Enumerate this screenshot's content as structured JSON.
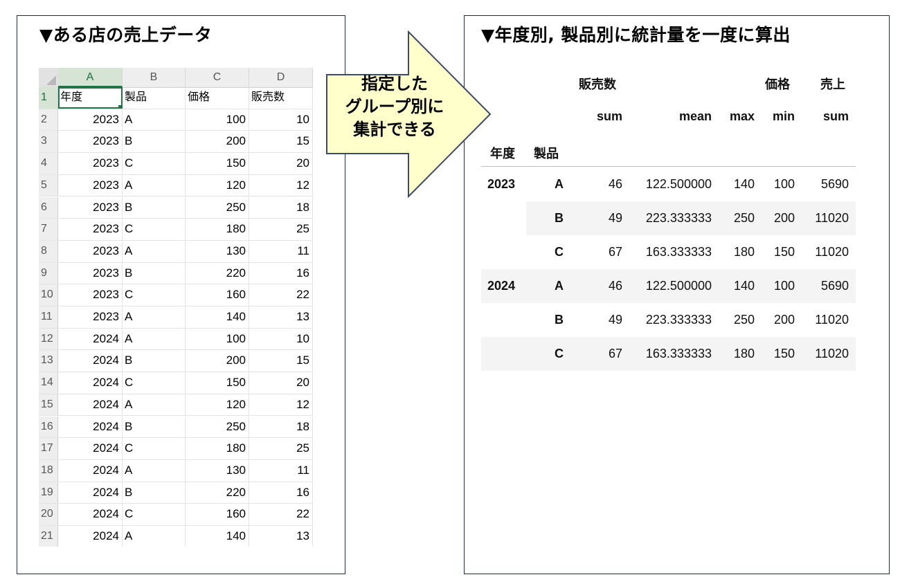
{
  "left": {
    "title": "▼ある店の売上データ",
    "sheet": {
      "columns": [
        "A",
        "B",
        "C",
        "D"
      ],
      "header": [
        "年度",
        "製品",
        "価格",
        "販売数"
      ],
      "rows": [
        [
          "2",
          "2023",
          "A",
          "100",
          "10"
        ],
        [
          "3",
          "2023",
          "B",
          "200",
          "15"
        ],
        [
          "4",
          "2023",
          "C",
          "150",
          "20"
        ],
        [
          "5",
          "2023",
          "A",
          "120",
          "12"
        ],
        [
          "6",
          "2023",
          "B",
          "250",
          "18"
        ],
        [
          "7",
          "2023",
          "C",
          "180",
          "25"
        ],
        [
          "8",
          "2023",
          "A",
          "130",
          "11"
        ],
        [
          "9",
          "2023",
          "B",
          "220",
          "16"
        ],
        [
          "10",
          "2023",
          "C",
          "160",
          "22"
        ],
        [
          "11",
          "2023",
          "A",
          "140",
          "13"
        ],
        [
          "12",
          "2024",
          "A",
          "100",
          "10"
        ],
        [
          "13",
          "2024",
          "B",
          "200",
          "15"
        ],
        [
          "14",
          "2024",
          "C",
          "150",
          "20"
        ],
        [
          "15",
          "2024",
          "A",
          "120",
          "12"
        ],
        [
          "16",
          "2024",
          "B",
          "250",
          "18"
        ],
        [
          "17",
          "2024",
          "C",
          "180",
          "25"
        ],
        [
          "18",
          "2024",
          "A",
          "130",
          "11"
        ],
        [
          "19",
          "2024",
          "B",
          "220",
          "16"
        ],
        [
          "20",
          "2024",
          "C",
          "160",
          "22"
        ],
        [
          "21",
          "2024",
          "A",
          "140",
          "13"
        ]
      ]
    }
  },
  "arrow": {
    "lines": [
      "指定した",
      "グループ別に",
      "集計できる"
    ],
    "fill": "#ffffcc",
    "stroke": "#3a4a66"
  },
  "right": {
    "title": "▼年度別, 製品別に統計量を一度に算出",
    "table": {
      "top_headers": [
        "販売数",
        "価格",
        "売上"
      ],
      "stat_headers": [
        "sum",
        "mean",
        "max",
        "min",
        "sum"
      ],
      "index_names": [
        "年度",
        "製品"
      ],
      "groups": [
        {
          "year": "2023",
          "rows": [
            {
              "product": "A",
              "values": [
                "46",
                "122.500000",
                "140",
                "100",
                "5690"
              ]
            },
            {
              "product": "B",
              "values": [
                "49",
                "223.333333",
                "250",
                "200",
                "11020"
              ]
            },
            {
              "product": "C",
              "values": [
                "67",
                "163.333333",
                "180",
                "150",
                "11020"
              ]
            }
          ]
        },
        {
          "year": "2024",
          "rows": [
            {
              "product": "A",
              "values": [
                "46",
                "122.500000",
                "140",
                "100",
                "5690"
              ]
            },
            {
              "product": "B",
              "values": [
                "49",
                "223.333333",
                "250",
                "200",
                "11020"
              ]
            },
            {
              "product": "C",
              "values": [
                "67",
                "163.333333",
                "180",
                "150",
                "11020"
              ]
            }
          ]
        }
      ]
    }
  }
}
